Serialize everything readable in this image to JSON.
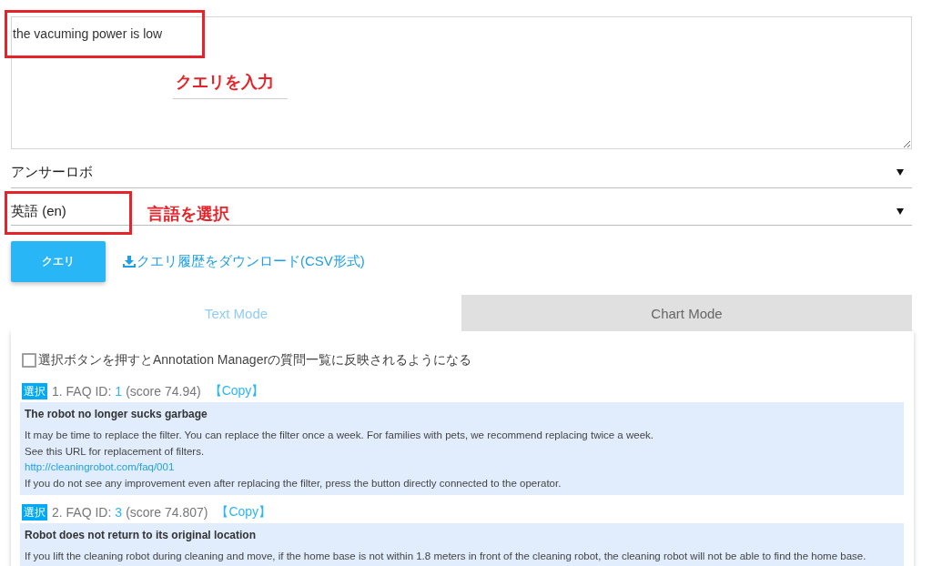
{
  "query": {
    "value": "the vacuming power is low",
    "highlighted": true,
    "annotation": "クエリを入力"
  },
  "selects": [
    {
      "value": "アンサーロボ",
      "highlighted": false
    },
    {
      "value": "英語 (en)",
      "highlighted": true,
      "annotation": "言語を選択"
    }
  ],
  "query_button": "クエリ",
  "download_link": "クエリ履歴をダウンロード(CSV形式)",
  "tabs": [
    {
      "label": "Text Mode",
      "selected": true
    },
    {
      "label": "Chart Mode",
      "selected": false
    }
  ],
  "option": {
    "label": "選択ボタンを押すとAnnotation Managerの質問一覧に反映されるようになる",
    "checked": false
  },
  "results": [
    {
      "select": "選択",
      "label": "1. FAQ ID:",
      "id": "1",
      "score": "(score 74.94)",
      "copy": "【Copy】",
      "title": "The robot no longer sucks garbage",
      "lines": [
        {
          "kind": "text",
          "text": "It may be time to replace the filter. You can replace the filter once a week. For families with pets, we recommend replacing twice a week."
        },
        {
          "kind": "text",
          "text": "See this URL for replacement of filters."
        },
        {
          "kind": "link",
          "text": "http://cleaningrobot.com/faq/001"
        },
        {
          "kind": "text",
          "text": "If you do not see any improvement even after replacing the filter, press the button directly connected to the operator."
        }
      ]
    },
    {
      "select": "選択",
      "label": "2. FAQ ID:",
      "id": "3",
      "score": "(score 74.807)",
      "copy": "【Copy】",
      "title": "Robot does not return to its original location",
      "lines": [
        {
          "kind": "text",
          "text": "If you lift the cleaning robot during cleaning and move, if the home base is not within 1.8 meters in front of the cleaning robot, the cleaning robot will not be able to find the home base."
        }
      ]
    }
  ]
}
